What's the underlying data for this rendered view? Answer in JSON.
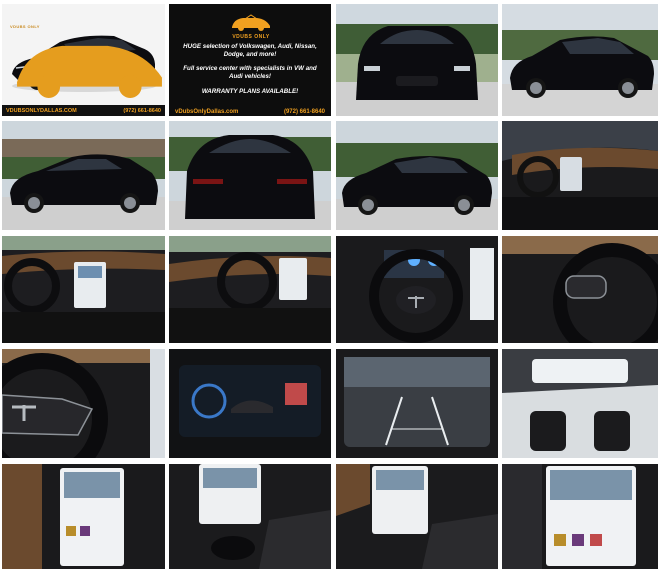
{
  "gallery": {
    "promo": {
      "brand": "VDUBS ONLY",
      "line1": "HUGE selection of Volkswagen, Audi, Nissan, Dodge, and more!",
      "line2": "Full service center with specialists in VW and Audi vehicles!",
      "line3": "WARRANTY PLANS AVAILABLE!",
      "website": "vDubsOnlyDallas.com",
      "phone": "(972) 661-8640"
    },
    "hero": {
      "brand": "VDUBS ONLY",
      "website": "VDUBSONLYDALLAS.COM",
      "phone": "(972) 661-8640"
    },
    "photos": [
      "exterior-front-quarter",
      "promo",
      "exterior-front",
      "exterior-front-right",
      "exterior-rear-left",
      "exterior-rear",
      "exterior-side-right",
      "interior-dashboard-wide",
      "interior-driver-view",
      "interior-driver-door-view",
      "interior-steering-wheel",
      "interior-steering-wheel-close",
      "interior-steering-buttons",
      "instrument-cluster",
      "backup-camera",
      "panoramic-roof-rear-seats",
      "center-screen-left",
      "center-console-cupholders",
      "center-console-screen",
      "center-screen-right"
    ]
  },
  "colors": {
    "accent": "#f0a020",
    "background": "#ffffff",
    "car": "#0c0c10"
  }
}
